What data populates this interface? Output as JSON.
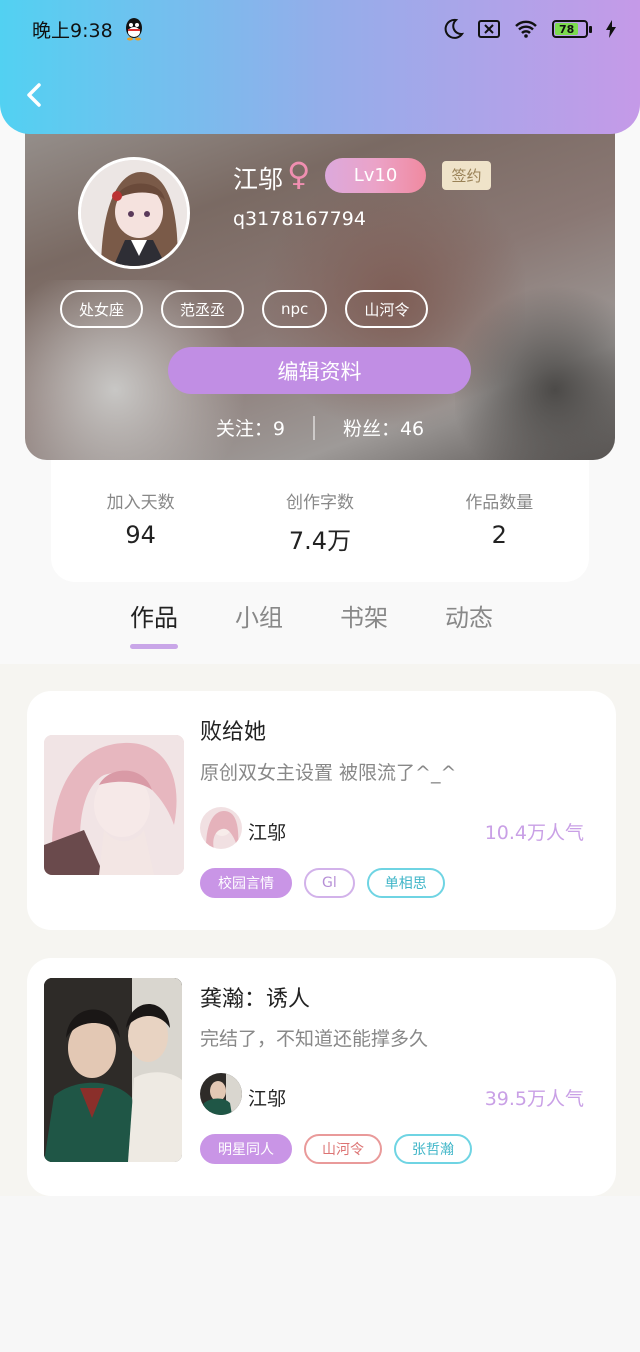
{
  "status_bar": {
    "time": "晚上9:38",
    "battery": "78"
  },
  "profile": {
    "name": "江邬",
    "gender_symbol": "♀",
    "level": "Lv10",
    "sign_badge": "签约",
    "uid": "q3178167794",
    "tags": [
      "处女座",
      "范丞丞",
      "npc",
      "山河令"
    ],
    "edit_label": "编辑资料",
    "follow_label": "关注：9",
    "fans_label": "粉丝：46"
  },
  "stats": [
    {
      "label": "加入天数",
      "value": "94"
    },
    {
      "label": "创作字数",
      "value": "7.4万"
    },
    {
      "label": "作品数量",
      "value": "2"
    }
  ],
  "tabs": [
    {
      "label": "作品",
      "active": true
    },
    {
      "label": "小组",
      "active": false
    },
    {
      "label": "书架",
      "active": false
    },
    {
      "label": "动态",
      "active": false
    }
  ],
  "works": [
    {
      "title": "败给她",
      "desc": "原创双女主设置 被限流了^_^",
      "author": "江邬",
      "popularity": "10.4万人气",
      "tags": [
        {
          "label": "校园言情",
          "style": "purple"
        },
        {
          "label": "Gl",
          "style": "lilac"
        },
        {
          "label": "单相思",
          "style": "teal"
        }
      ]
    },
    {
      "title": "龚瀚：诱人",
      "desc": "完结了，不知道还能撑多久",
      "author": "江邬",
      "popularity": "39.5万人气",
      "tags": [
        {
          "label": "明星同人",
          "style": "purple"
        },
        {
          "label": "山河令",
          "style": "red"
        },
        {
          "label": "张哲瀚",
          "style": "teal"
        }
      ]
    }
  ],
  "colors": {
    "accent": "#c18ee4",
    "header_start": "#52d1f2",
    "header_end": "#c59ae8"
  }
}
